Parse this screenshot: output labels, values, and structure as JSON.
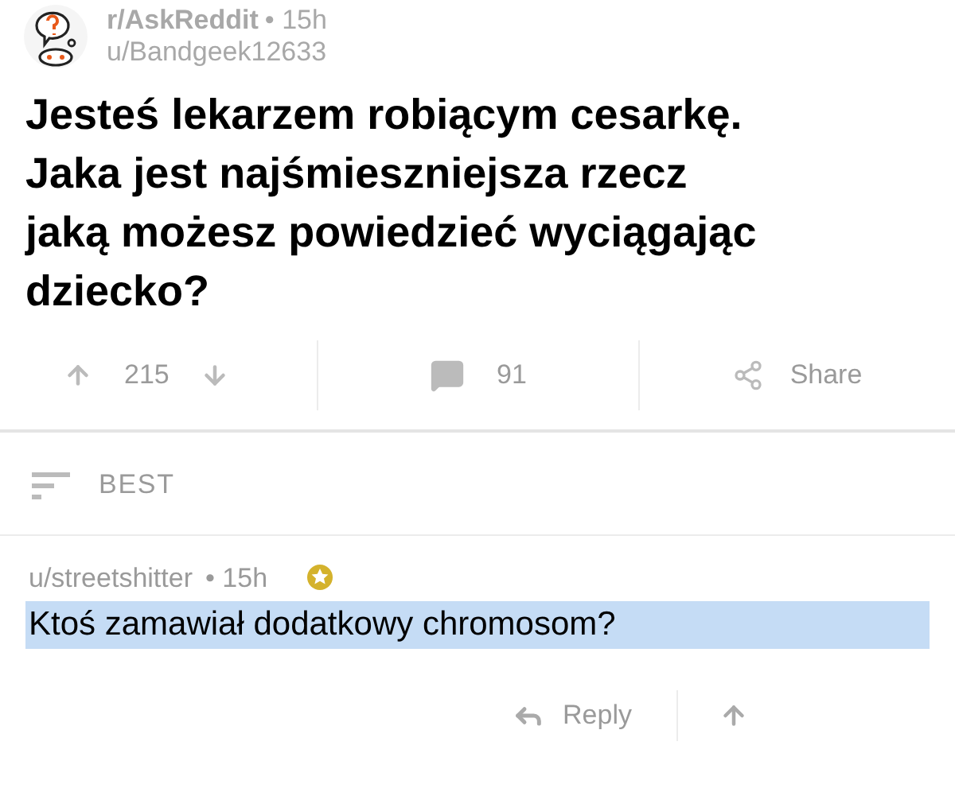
{
  "post": {
    "subreddit": "r/AskReddit",
    "time": "• 15h",
    "author": "u/Bandgeek12633",
    "title": "Jesteś lekarzem robiącym cesarkę. Jaka jest najśmieszniejsza rzecz jaką możesz powiedzieć wyciągając dziecko?",
    "score": "215",
    "comments": "91",
    "share": "Share"
  },
  "sort": {
    "label": "BEST"
  },
  "comment": {
    "author": "u/streetshitter",
    "time": "• 15h",
    "awarded": true,
    "body": "Ktoś zamawiał dodatkowy chromosom?",
    "selected": true,
    "reply": "Reply"
  }
}
